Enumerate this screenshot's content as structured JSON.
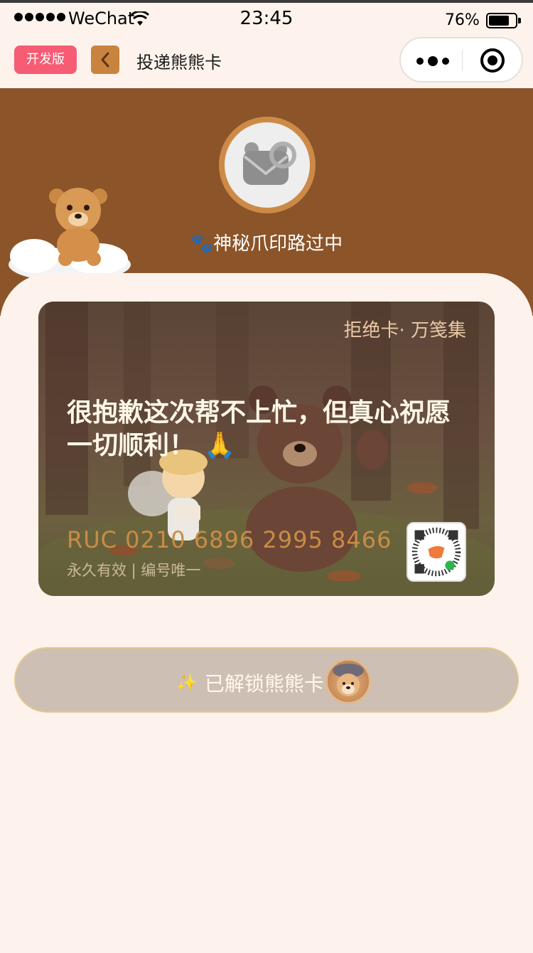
{
  "status_bar": {
    "carrier": "WeChat",
    "time": "23:45",
    "battery": "76%",
    "battery_level": 0.76
  },
  "nav": {
    "badge": "开发版",
    "title": "投递熊熊卡"
  },
  "header": {
    "status_text": "神秘爪印路过中",
    "status_icon": "paw-prints-icon"
  },
  "card": {
    "label": "拒绝卡· 万笺集",
    "message": "很抱歉这次帮不上忙，但真心祝愿一切顺利！",
    "message_emoji": "🙏",
    "number": "RUC 0210 6896 2995 8466",
    "validity": "永久有效 | 编号唯一"
  },
  "unlock_button": {
    "icon": "sparkles-icon",
    "label": "已解锁熊熊卡"
  },
  "colors": {
    "page_bg": "#fdf3ec",
    "header_bg": "#8b5429",
    "accent_orange": "#c8843e",
    "dev_badge": "#f65c73",
    "card_number": "#c98c44"
  }
}
